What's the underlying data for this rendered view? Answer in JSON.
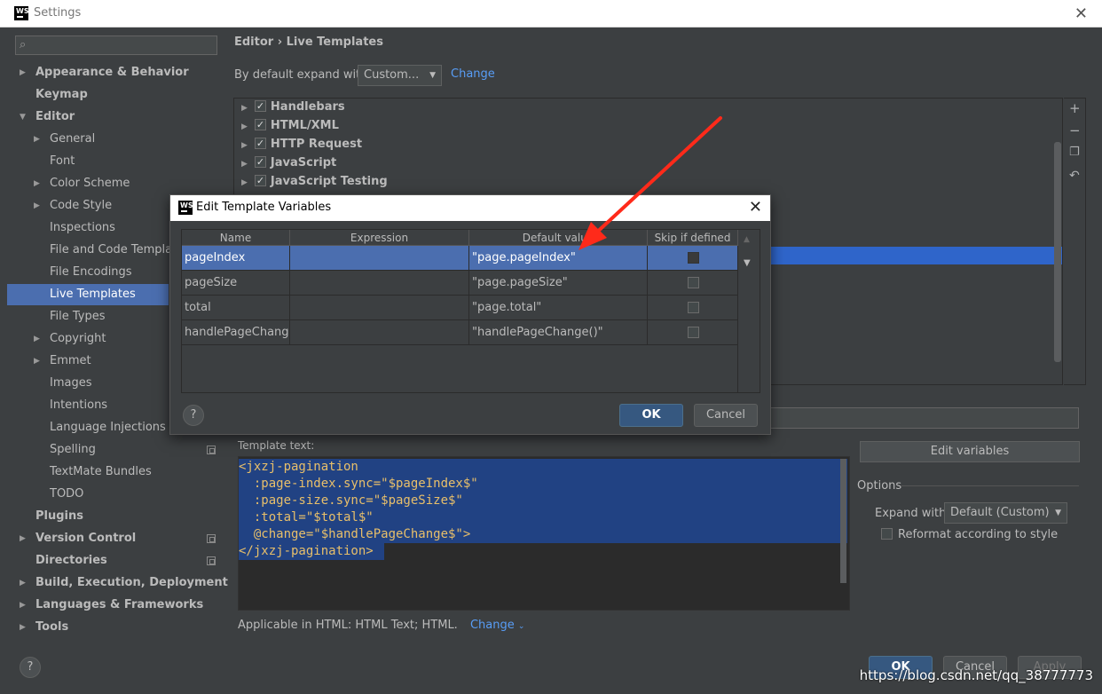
{
  "window": {
    "title": "Settings"
  },
  "sidebar": {
    "search_placeholder": "",
    "items": [
      {
        "label": "Appearance & Behavior"
      },
      {
        "label": "Keymap"
      },
      {
        "label": "Editor"
      },
      {
        "label": "General"
      },
      {
        "label": "Font"
      },
      {
        "label": "Color Scheme"
      },
      {
        "label": "Code Style"
      },
      {
        "label": "Inspections"
      },
      {
        "label": "File and Code Templates"
      },
      {
        "label": "File Encodings"
      },
      {
        "label": "Live Templates"
      },
      {
        "label": "File Types"
      },
      {
        "label": "Copyright"
      },
      {
        "label": "Emmet"
      },
      {
        "label": "Images"
      },
      {
        "label": "Intentions"
      },
      {
        "label": "Language Injections"
      },
      {
        "label": "Spelling"
      },
      {
        "label": "TextMate Bundles"
      },
      {
        "label": "TODO"
      },
      {
        "label": "Plugins"
      },
      {
        "label": "Version Control"
      },
      {
        "label": "Directories"
      },
      {
        "label": "Build, Execution, Deployment"
      },
      {
        "label": "Languages & Frameworks"
      },
      {
        "label": "Tools"
      }
    ]
  },
  "main": {
    "breadcrumb": "Editor  ›  Live Templates",
    "expand_label": "By default expand with",
    "expand_value": "Custom...",
    "change_link": "Change",
    "groups": [
      "Handlebars",
      "HTML/XML",
      "HTTP Request",
      "JavaScript",
      "JavaScript Testing"
    ],
    "template_text_label": "Template text:",
    "code_lines": [
      "<jxzj-pagination",
      "  :page-index.sync=\"$pageIndex$\"",
      "  :page-size.sync=\"$pageSize$\"",
      "  :total=\"$total$\"",
      "  @change=\"$handlePageChange$\">",
      "</jxzj-pagination>"
    ],
    "edit_variables": "Edit variables",
    "options_label": "Options",
    "expand_with_label": "Expand with",
    "expand_with_value": "Default (Custom)",
    "reformat_label": "Reformat according to style",
    "applicable": "Applicable in HTML: HTML Text; HTML.",
    "applicable_change": "Change"
  },
  "footer": {
    "ok": "OK",
    "cancel": "Cancel",
    "apply": "Apply"
  },
  "watermark": "https://blog.csdn.net/qq_38777773",
  "dialog": {
    "title": "Edit Template Variables",
    "columns": [
      "Name",
      "Expression",
      "Default value",
      "Skip if defined"
    ],
    "rows": [
      {
        "name": "pageIndex",
        "expression": "",
        "default": "\"page.pageIndex\""
      },
      {
        "name": "pageSize",
        "expression": "",
        "default": "\"page.pageSize\""
      },
      {
        "name": "total",
        "expression": "",
        "default": "\"page.total\""
      },
      {
        "name": "handlePageChange",
        "expression": "",
        "default": "\"handlePageChange()\""
      }
    ],
    "ok": "OK",
    "cancel": "Cancel"
  },
  "colors": {
    "accent": "#4b6eaf",
    "selection": "#214283",
    "link": "#589df6",
    "annotation": "#ff2a1a"
  }
}
